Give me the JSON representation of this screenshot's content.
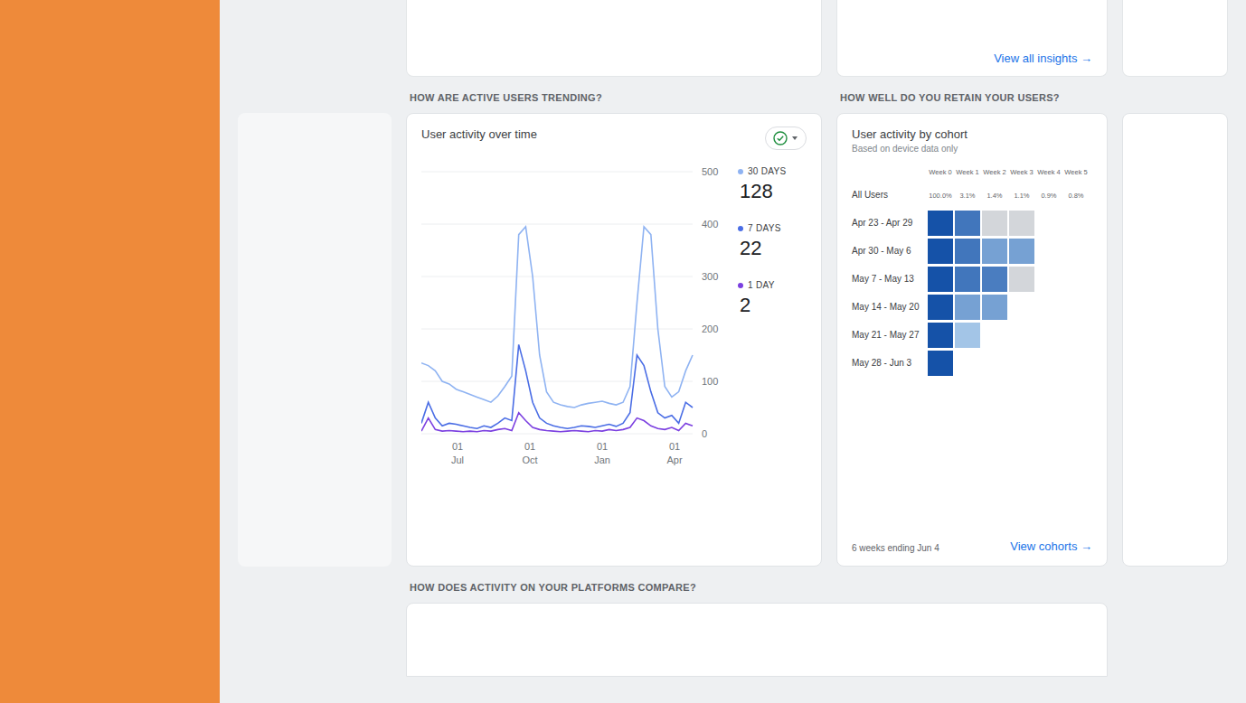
{
  "insights": {
    "link": "View all insights →"
  },
  "sections": {
    "trending": "HOW ARE ACTIVE USERS TRENDING?",
    "retention": "HOW WELL DO YOU RETAIN YOUR USERS?",
    "platforms": "HOW DOES ACTIVITY ON YOUR PLATFORMS COMPARE?"
  },
  "chart": {
    "title": "User activity over time",
    "y_max": 500,
    "y_ticks": [
      "500",
      "400",
      "300",
      "200",
      "100",
      "0"
    ],
    "x_ticks": [
      {
        "day": "01",
        "month": "Jul"
      },
      {
        "day": "01",
        "month": "Oct"
      },
      {
        "day": "01",
        "month": "Jan"
      },
      {
        "day": "01",
        "month": "Apr"
      }
    ],
    "series": [
      {
        "label": "30 DAYS",
        "value": "128",
        "color": "#8fb3f2",
        "values": [
          135,
          130,
          120,
          100,
          95,
          85,
          80,
          75,
          70,
          65,
          60,
          72,
          90,
          110,
          380,
          395,
          300,
          150,
          80,
          60,
          55,
          52,
          50,
          55,
          58,
          60,
          62,
          58,
          55,
          60,
          90,
          250,
          395,
          380,
          200,
          90,
          70,
          80,
          120,
          150
        ]
      },
      {
        "label": "7 DAYS",
        "value": "22",
        "color": "#4a6de5",
        "values": [
          20,
          60,
          30,
          15,
          20,
          18,
          15,
          12,
          10,
          15,
          12,
          20,
          30,
          25,
          170,
          120,
          60,
          30,
          20,
          15,
          12,
          10,
          12,
          15,
          14,
          12,
          15,
          18,
          14,
          20,
          40,
          150,
          130,
          80,
          40,
          30,
          35,
          20,
          60,
          50
        ]
      },
      {
        "label": "1 DAY",
        "value": "2",
        "color": "#7b3fe0",
        "values": [
          5,
          30,
          8,
          5,
          6,
          5,
          4,
          5,
          4,
          6,
          5,
          8,
          10,
          6,
          40,
          25,
          12,
          8,
          6,
          5,
          4,
          5,
          6,
          5,
          4,
          6,
          5,
          8,
          6,
          8,
          12,
          30,
          25,
          15,
          10,
          8,
          12,
          6,
          20,
          15
        ]
      }
    ]
  },
  "cohort": {
    "title": "User activity by cohort",
    "subtitle": "Based on device data only",
    "columns": [
      "Week 0",
      "Week 1",
      "Week 2",
      "Week 3",
      "Week 4",
      "Week 5"
    ],
    "all_users": {
      "label": "All Users",
      "values": [
        "100.0%",
        "3.1%",
        "1.4%",
        "1.1%",
        "0.9%",
        "0.8%"
      ]
    },
    "rows": [
      {
        "label": "Apr 23 - Apr 29",
        "cells": [
          1,
          0.75,
          0,
          0
        ]
      },
      {
        "label": "Apr 30 - May 6",
        "cells": [
          1,
          0.75,
          0.45,
          0.45
        ]
      },
      {
        "label": "May 7 - May 13",
        "cells": [
          1,
          0.75,
          0.7,
          0
        ]
      },
      {
        "label": "May 14 - May 20",
        "cells": [
          1,
          0.45,
          0.45
        ]
      },
      {
        "label": "May 21 - May 27",
        "cells": [
          1,
          0.2
        ]
      },
      {
        "label": "May 28 - Jun 3",
        "cells": [
          1
        ]
      }
    ],
    "footer": "6 weeks ending Jun 4",
    "link": "View cohorts →"
  }
}
